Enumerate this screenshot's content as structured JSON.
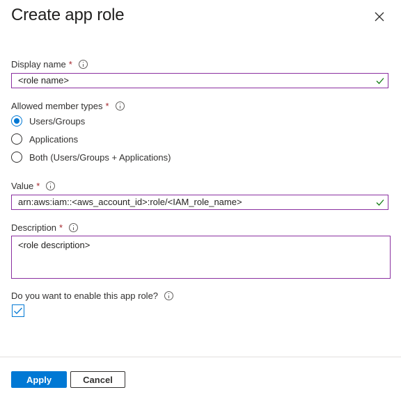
{
  "title": "Create app role",
  "display_name": {
    "label": "Display name",
    "required_mark": "*",
    "value": "<role name>"
  },
  "member_types": {
    "label": "Allowed member types",
    "required_mark": "*",
    "options": [
      {
        "label": "Users/Groups",
        "selected": true
      },
      {
        "label": "Applications",
        "selected": false
      },
      {
        "label": "Both (Users/Groups + Applications)",
        "selected": false
      }
    ]
  },
  "value_field": {
    "label": "Value",
    "required_mark": "*",
    "value": "arn:aws:iam::<aws_account_id>:role/<IAM_role_name>"
  },
  "description": {
    "label": "Description",
    "required_mark": "*",
    "value": "<role description>"
  },
  "enable": {
    "label": "Do you want to enable this app role?",
    "checked": true
  },
  "buttons": {
    "apply": "Apply",
    "cancel": "Cancel"
  },
  "colors": {
    "accent": "#0078d4",
    "valid_check": "#107c10",
    "field_border": "#8a2fa0",
    "required": "#a4262c"
  }
}
